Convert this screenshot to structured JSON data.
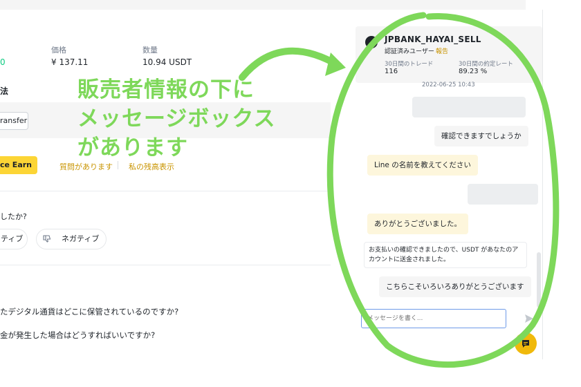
{
  "order": {
    "amount_value": "0",
    "price_label": "価格",
    "price_value": "¥ 137.11",
    "quantity_label": "数量",
    "quantity_value": "10.94 USDT",
    "method_label": "法",
    "transfer_label": "ransfer",
    "earn_button": "ce Earn",
    "question_link": "質問があります",
    "balance_link": "私の残高表示"
  },
  "feedback": {
    "question": "したか?",
    "positive": "ティブ",
    "negative": "ネガティブ"
  },
  "faq": {
    "items": [
      "たデジタル通貨はどこに保管されているのですか?",
      "金が発生した場合はどうすればいいですか?"
    ]
  },
  "seller": {
    "name": "JPBANK_HAYAI_SELL",
    "verified": "認証済みユーザー",
    "report": "報告",
    "trades_label": "30日間のトレード",
    "trades_value": "116",
    "completion_label": "30日間の約定レート",
    "completion_value": "89.23 %"
  },
  "chat": {
    "timestamp": "2022-06-25 10:43",
    "messages": [
      {
        "text": "確認できますでしょうか",
        "side": "right"
      },
      {
        "text": "Line の名前を教えてください",
        "side": "left"
      },
      {
        "text": "ありがとうございました。",
        "side": "left"
      },
      {
        "text": "こちらこそいろいろありがとうございます",
        "side": "right"
      }
    ],
    "system_message": "お支払いの確認できましたので、USDT があなたのアカウントに送金されました。",
    "input_placeholder": "メッセージを書く..."
  },
  "annotation": {
    "lines": [
      "販売者情報の下に",
      "メッセージボックス",
      "があります"
    ],
    "color": "#7ed85a"
  },
  "colors": {
    "accent": "#fcd535",
    "link": "#c99400",
    "annotation": "#7ed85a"
  }
}
